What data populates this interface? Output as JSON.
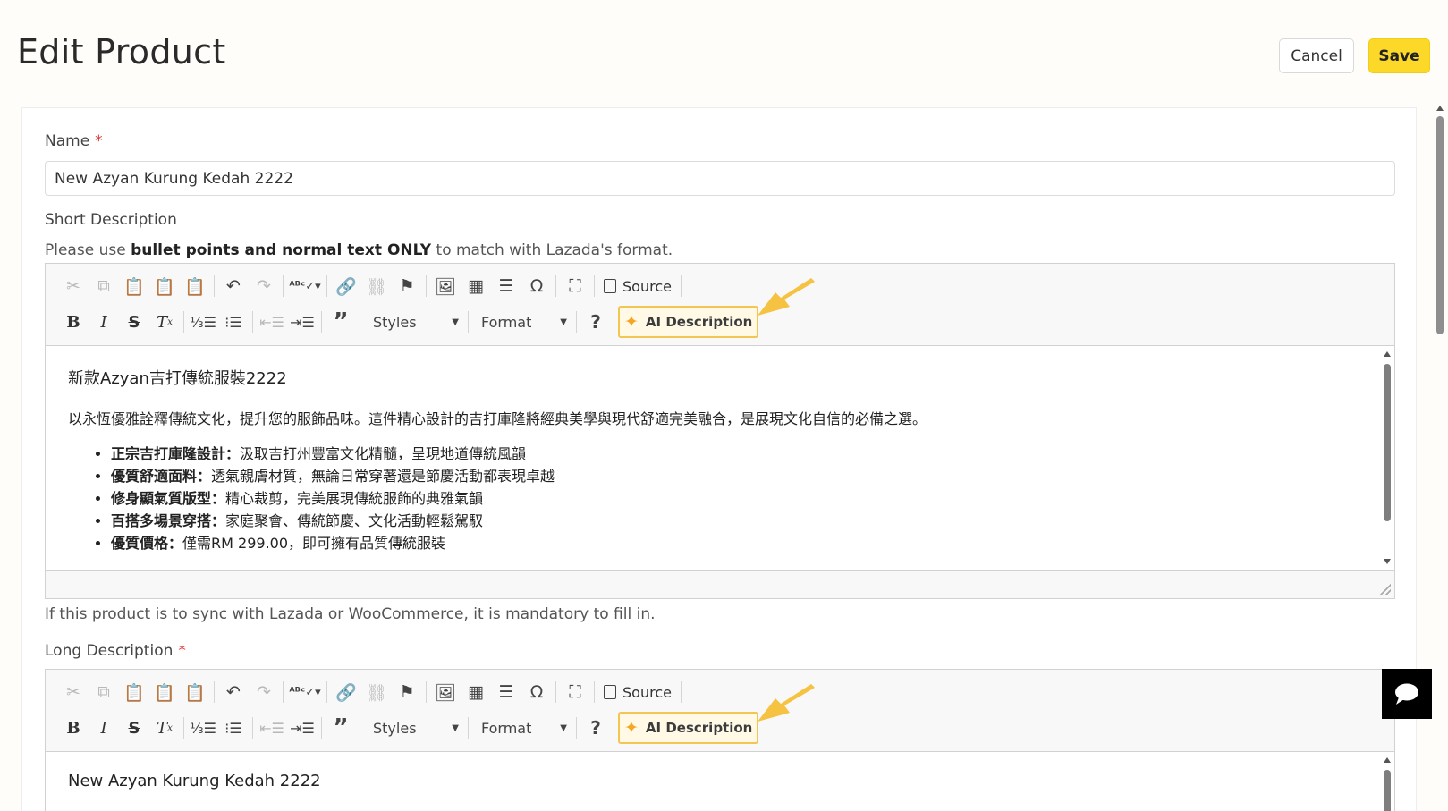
{
  "header": {
    "title": "Edit Product",
    "cancel_label": "Cancel",
    "save_label": "Save"
  },
  "form": {
    "name_label": "Name",
    "required_mark": "*",
    "name_value": "New Azyan Kurung Kedah 2222",
    "short_desc_label": "Short Description",
    "short_desc_hint": {
      "prefix": "Please use ",
      "bold": "bullet points and normal text ONLY",
      "suffix": " to match with Lazada's format."
    },
    "short_desc_footer": "If this product is to sync with Lazada or WooCommerce, it is mandatory to fill in.",
    "long_desc_label": "Long Description"
  },
  "toolbar": {
    "source_label": "Source",
    "styles_label": "Styles",
    "format_label": "Format",
    "ai_label": "AI Description",
    "help_label": "?",
    "icons_row1": [
      "cut-icon",
      "copy-icon",
      "paste-icon",
      "paste-text-icon",
      "paste-word-icon",
      "undo-icon",
      "redo-icon",
      "spellcheck-icon",
      "link-icon",
      "unlink-icon",
      "anchor-icon",
      "image-icon",
      "table-icon",
      "horizontal-rule-icon",
      "special-char-icon",
      "maximize-icon",
      "source-icon"
    ],
    "icons_row2": [
      "bold-icon",
      "italic-icon",
      "strike-icon",
      "remove-format-icon",
      "numbered-list-icon",
      "bulleted-list-icon",
      "outdent-icon",
      "indent-icon",
      "blockquote-icon",
      "help-icon",
      "ai-sparkle-icon"
    ],
    "accent_color": "#f3c653"
  },
  "short_description": {
    "heading": "新款Azyan吉打傳統服裝2222",
    "intro": "以永恆優雅詮釋傳統文化，提升您的服飾品味。這件精心設計的吉打庫隆將經典美學與現代舒適完美融合，是展現文化自信的必備之選。",
    "bullets": [
      {
        "title": "正宗吉打庫隆設計：",
        "text": "汲取吉打州豐富文化精髓，呈現地道傳統風韻"
      },
      {
        "title": "優質舒適面料：",
        "text": "透氣親膚材質，無論日常穿著還是節慶活動都表現卓越"
      },
      {
        "title": "修身顯氣質版型：",
        "text": "精心裁剪，完美展現傳統服飾的典雅氣韻"
      },
      {
        "title": "百搭多場景穿搭：",
        "text": "家庭聚會、傳統節慶、文化活動輕鬆駕馭"
      },
      {
        "title": "優質價格：",
        "text": "僅需RM 299.00，即可擁有品質傳統服裝"
      }
    ]
  },
  "long_description": {
    "heading": "New Azyan Kurung Kedah 2222"
  },
  "colors": {
    "save_button": "#fcd829",
    "required": "#e03333",
    "arrow": "#f5c242"
  }
}
